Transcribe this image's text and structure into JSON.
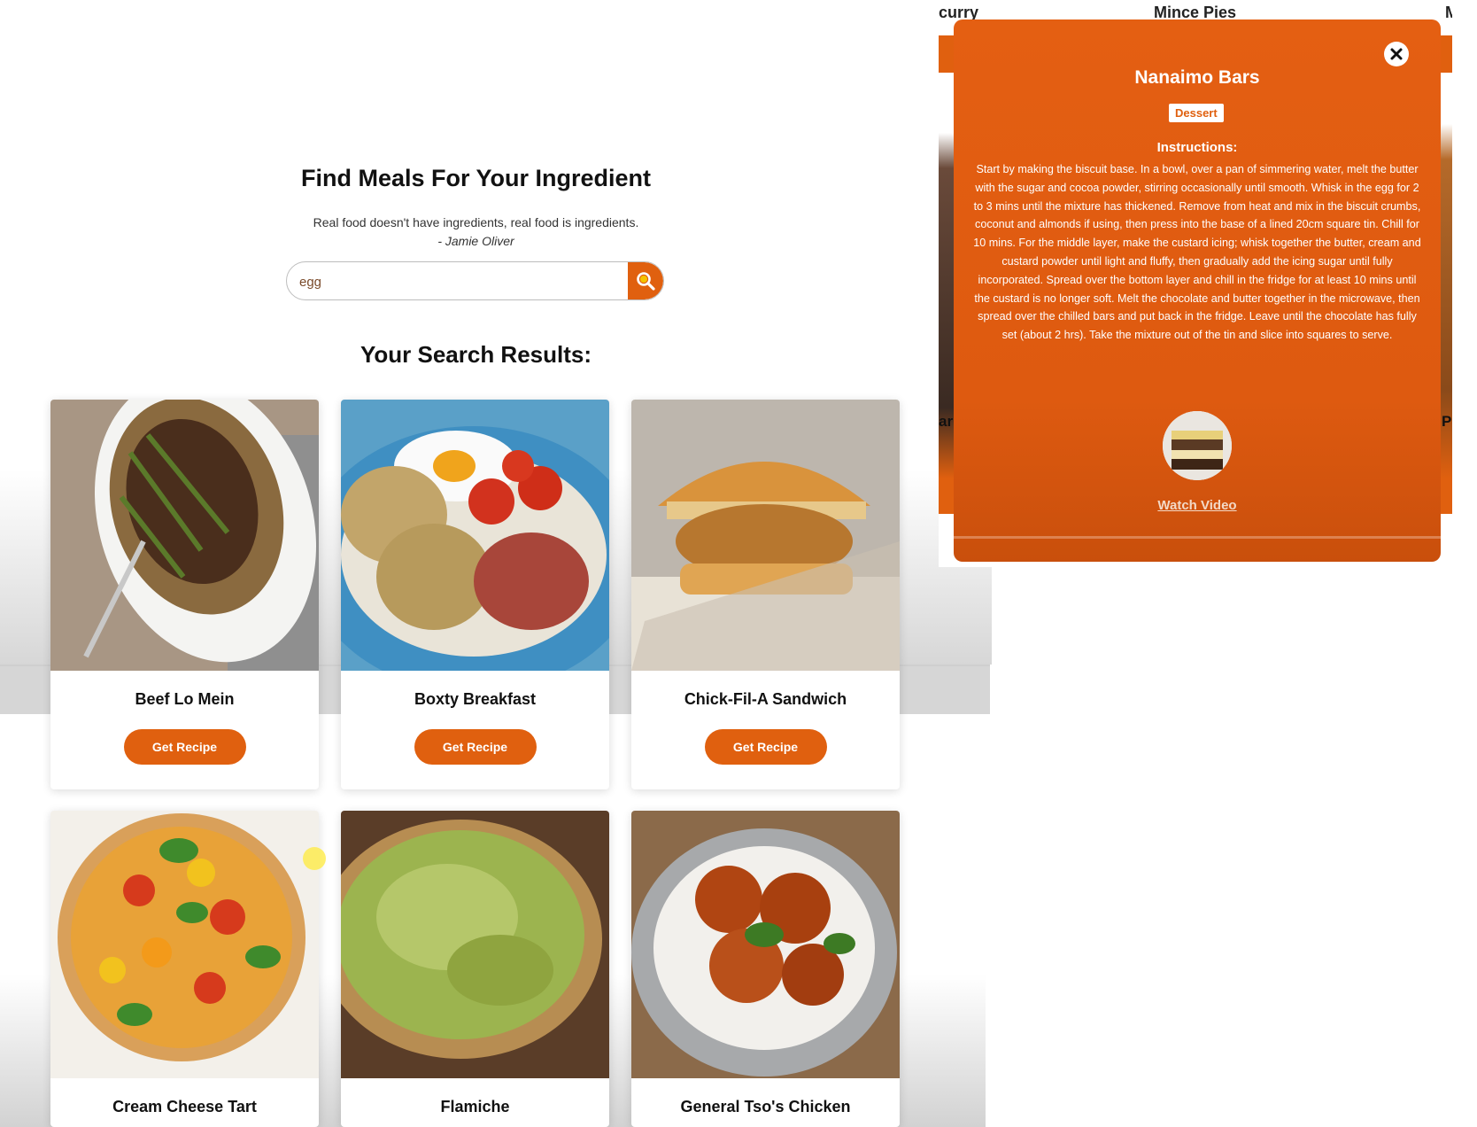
{
  "header": {
    "title": "Find Meals For Your Ingredient",
    "quote": "Real food doesn't have ingredients, real food is ingredients.",
    "quote_author": "- Jamie Oliver"
  },
  "search": {
    "value": "egg",
    "placeholder": "",
    "button_icon": "search-icon"
  },
  "results": {
    "title": "Your Search Results:",
    "meals": [
      {
        "name": "Beef Lo Mein",
        "button": "Get Recipe"
      },
      {
        "name": "Boxty Breakfast",
        "button": "Get Recipe"
      },
      {
        "name": "Chick-Fil-A Sandwich",
        "button": "Get Recipe"
      },
      {
        "name": "Cream Cheese Tart"
      },
      {
        "name": "Flamiche"
      },
      {
        "name": "General Tso's Chicken"
      }
    ]
  },
  "background_strip": {
    "left_label": "curry",
    "middle_label": "Mince Pies",
    "right_label": "M",
    "side_left": "ar",
    "side_right": "P"
  },
  "modal": {
    "title": "Nanaimo Bars",
    "category": "Dessert",
    "instructions_heading": "Instructions:",
    "instructions": "Start by making the biscuit base. In a bowl, over a pan of simmering water, melt the butter with the sugar and cocoa powder, stirring occasionally until smooth. Whisk in the egg for 2 to 3 mins until the mixture has thickened. Remove from heat and mix in the biscuit crumbs, coconut and almonds if using, then press into the base of a lined 20cm square tin. Chill for 10 mins. For the middle layer, make the custard icing; whisk together the butter, cream and custard powder until light and fluffy, then gradually add the icing sugar until fully incorporated. Spread over the bottom layer and chill in the fridge for at least 10 mins until the custard is no longer soft. Melt the chocolate and butter together in the microwave, then spread over the chilled bars and put back in the fridge. Leave until the chocolate has fully set (about 2 hrs). Take the mixture out of the tin and slice into squares to serve.",
    "video_link": "Watch Video",
    "close_icon": "close-icon"
  },
  "colors": {
    "accent": "#e0600f",
    "text": "#111111",
    "modal_bg": "#e45f12"
  }
}
